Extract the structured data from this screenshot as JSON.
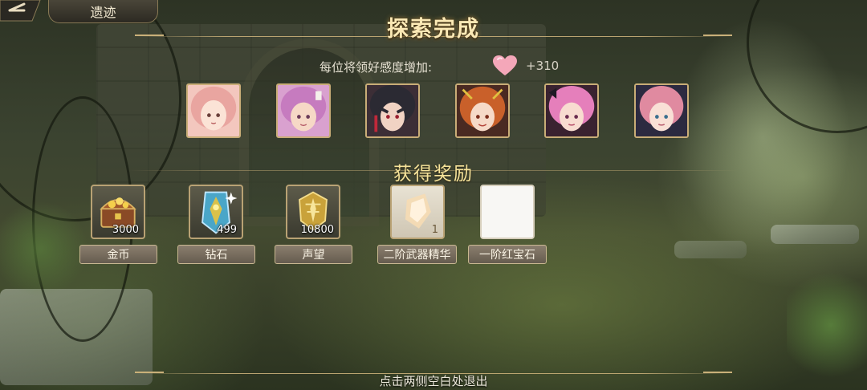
{
  "header": {
    "title_tab": "遗迹",
    "main_title": "探索完成"
  },
  "affection": {
    "label": "每位将领好感度增加:",
    "icon": "heart-icon",
    "value": "+310"
  },
  "characters": [
    {
      "name": "character-1",
      "hair": "#e9a5a0"
    },
    {
      "name": "character-2",
      "hair": "#c67bbf"
    },
    {
      "name": "character-3",
      "hair": "#2b2a33"
    },
    {
      "name": "character-4",
      "hair": "#c9602a"
    },
    {
      "name": "character-5",
      "hair": "#e57fbb"
    },
    {
      "name": "character-6",
      "hair": "#e08aa0"
    }
  ],
  "rewards": {
    "title": "获得奖励",
    "items": [
      {
        "label": "金币",
        "count": "3000",
        "icon": "treasure-chest-icon"
      },
      {
        "label": "钻石",
        "count": "499",
        "icon": "diamond-crystal-icon"
      },
      {
        "label": "声望",
        "count": "10800",
        "icon": "prestige-emblem-icon"
      },
      {
        "label": "二阶武器精华",
        "count": "1",
        "icon": "weapon-essence-icon"
      },
      {
        "label": "一阶红宝石",
        "count": "",
        "icon": "ruby-icon"
      }
    ]
  },
  "footer": {
    "exit_hint": "点击两侧空白处退出"
  }
}
